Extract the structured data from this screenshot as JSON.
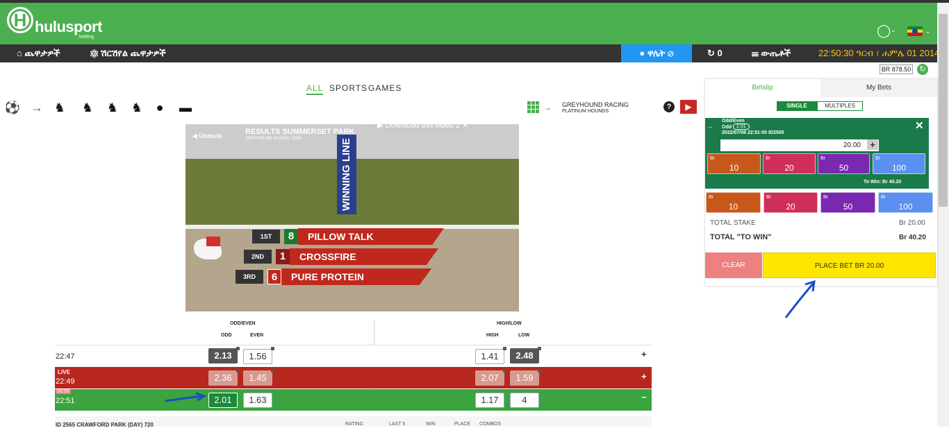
{
  "brand": {
    "logo_letter": "H",
    "name": "hulusport",
    "sub": "betting"
  },
  "nav": {
    "home": "ጨዋታዎች",
    "featured": "ሽርሽየል ጨዋታዎች",
    "results": "ዋሌት",
    "history_count": "0",
    "list": "ውጤቶች",
    "clock": "22:50:30 ዓርብ ፣ ሐምሌ 01 2014"
  },
  "balance": "BR 878.50",
  "tabs": [
    "ALL",
    "SPORTS",
    "GAMES"
  ],
  "sport_icons": [
    "soccer-ball-icon",
    "greyhound-icon",
    "horse-racing-icon",
    "harness-racing-icon",
    "trotting-icon",
    "showjump-icon",
    "wheel-icon",
    "tennis-icon",
    "car-icon"
  ],
  "game": {
    "title": "GREYHOUND RACING",
    "subtitle": "PLATINUM HOUNDS"
  },
  "video": {
    "unmute": "Unmute",
    "title": "RESULTS SUMMERSET PARK",
    "sub": "GREYHOUND RACING  720M",
    "winning_line": "WINNING LINE",
    "download": "Download this video",
    "download_count": "2",
    "placings": [
      {
        "pos": "1ST",
        "num": "8",
        "name": "PILLOW TALK",
        "color": "#1b7a2e"
      },
      {
        "pos": "2ND",
        "num": "1",
        "name": "CROSSFIRE",
        "color": "#8b1a1a"
      },
      {
        "pos": "3RD",
        "num": "6",
        "name": "PURE PROTEIN",
        "color": "#c0281e"
      }
    ]
  },
  "markets": {
    "odd_even": "ODD/EVEN",
    "odd": "ODD",
    "even": "EVEN",
    "high_low": "HIGH/LOW",
    "high": "HIGH",
    "low": "LOW"
  },
  "rows": [
    {
      "time": "22:47",
      "badge": "",
      "odd": "2.13",
      "even": "1.56",
      "high": "1.41",
      "low": "2.48",
      "toggle": "+"
    },
    {
      "time": "22:49",
      "badge": "LIVE",
      "odd": "2.36",
      "even": "1.45",
      "high": "2.07",
      "low": "1.59",
      "toggle": "+"
    },
    {
      "time": "22:51",
      "badge": "00:30",
      "odd": "2.01",
      "even": "1.63",
      "high": "1.17",
      "low": "4",
      "toggle": "−"
    }
  ],
  "footer_row": {
    "event": "ID 2565 CRAWFORD PARK (DAY) 720",
    "rating": "RATING",
    "last5": "LAST 5",
    "win": "WIN",
    "place": "PLACE",
    "combo": "COMBOS"
  },
  "betslip": {
    "tab_betslip": "Betslip",
    "tab_mybets": "My Bets",
    "single": "SINGLE",
    "multiples": "MULTIPLES",
    "selection": {
      "market": "Odd/Even",
      "pick": "Odd",
      "odds": "2.01",
      "meta": "2022/07/08 22:51:00 ID2565",
      "stake": "20.00",
      "to_win": "To Win: Br 40.20"
    },
    "currency": "Br",
    "quick_stakes": [
      {
        "value": "10",
        "color": "#c8571b"
      },
      {
        "value": "20",
        "color": "#cf2e5a"
      },
      {
        "value": "50",
        "color": "#7b28b0"
      },
      {
        "value": "100",
        "color": "#5b8ff0"
      }
    ],
    "total_stake_label": "TOTAL STAKE",
    "total_stake": "Br 20.00",
    "total_win_label": "TOTAL \"TO WIN\"",
    "total_win": "Br 40.20",
    "clear": "CLEAR",
    "place_bet": "PLACE BET   BR 20.00"
  }
}
